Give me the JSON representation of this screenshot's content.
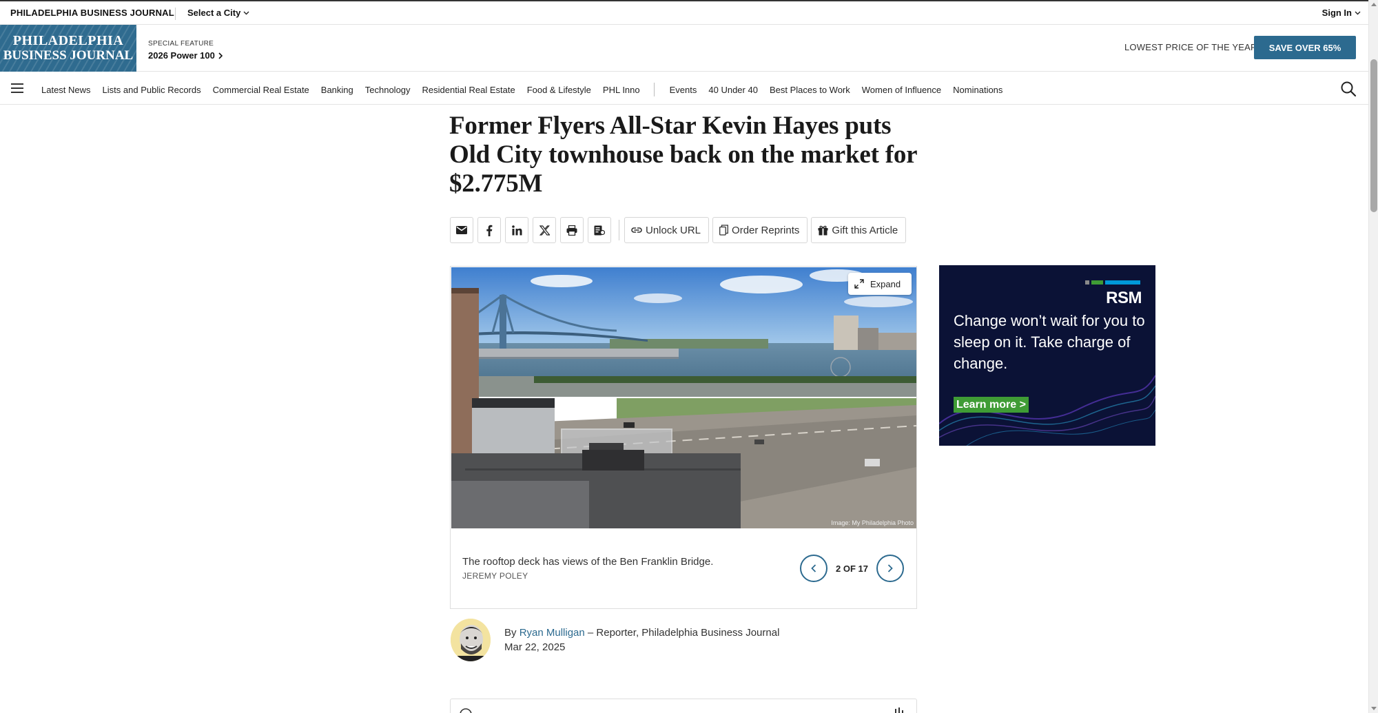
{
  "topbar": {
    "brand": "PHILADELPHIA BUSINESS JOURNAL",
    "city_select": "Select a City",
    "sign_in": "Sign In"
  },
  "header": {
    "logo_line1": "PHILADELPHIA",
    "logo_line2": "BUSINESS JOURNAL",
    "special_kicker": "SPECIAL FEATURE",
    "special_link": "2026 Power 100",
    "promo_text": "LOWEST PRICE OF THE YEAR",
    "save_button": "SAVE OVER 65%"
  },
  "nav": {
    "items": [
      "Latest News",
      "Lists and Public Records",
      "Commercial Real Estate",
      "Banking",
      "Technology",
      "Residential Real Estate",
      "Food & Lifestyle",
      "PHL Inno"
    ],
    "items2": [
      "Events",
      "40 Under 40",
      "Best Places to Work",
      "Women of Influence",
      "Nominations"
    ]
  },
  "article": {
    "headline": "Former Flyers All-Star Kevin Hayes puts Old City townhouse back on the market for $2.775M",
    "tools": {
      "unlock": "Unlock URL",
      "reprints": "Order Reprints",
      "gift": "Gift this Article"
    },
    "gallery": {
      "expand": "Expand",
      "credit": "Image: My Philadelphia Photo",
      "caption": "The rooftop deck has views of the Ben Franklin Bridge.",
      "photographer": "JEREMY POLEY",
      "counter": "2 OF 17"
    },
    "byline": {
      "by": "By",
      "author": "Ryan Mulligan",
      "role": " – Reporter, Philadelphia Business Journal",
      "date": "Mar 22, 2025"
    }
  },
  "ad": {
    "brand": "RSM",
    "message": "Change won’t wait for you to sleep on it. Take charge of change.",
    "cta": "Learn more >",
    "colors": {
      "background": "#0b1236",
      "cta": "#3f9c35",
      "bar1": "#8a8a8a",
      "bar2": "#3f9c35",
      "bar3": "#0099d8"
    }
  },
  "theme": {
    "accent": "#2c6a8f"
  }
}
